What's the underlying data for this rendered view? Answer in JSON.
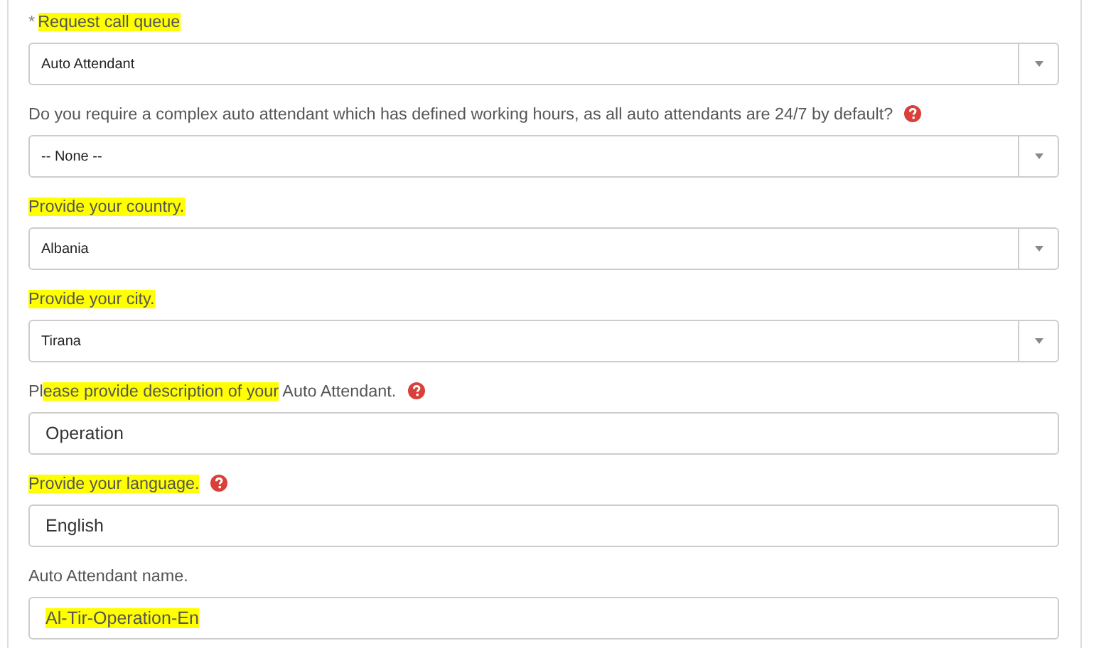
{
  "fields": [
    {
      "kind": "select",
      "required_mark": "*",
      "help": false,
      "label_parts": [
        {
          "text": "Request call queue",
          "highlighted": true
        }
      ],
      "value": "Auto Attendant"
    },
    {
      "kind": "select",
      "help": true,
      "label_parts": [
        {
          "text": "Do you require a complex auto attendant which has defined working hours, as all auto attendants are 24/7 by default?",
          "highlighted": false
        }
      ],
      "value": "-- None --"
    },
    {
      "kind": "select",
      "help": false,
      "label_parts": [
        {
          "text": "Provide your country.",
          "highlighted": true
        }
      ],
      "value": "Albania"
    },
    {
      "kind": "select",
      "help": false,
      "label_parts": [
        {
          "text": "Provide your city.",
          "highlighted": true
        }
      ],
      "value": "Tirana"
    },
    {
      "kind": "text",
      "help": true,
      "label_parts": [
        {
          "text": "Pl",
          "highlighted": false
        },
        {
          "text": "ease provide description of your",
          "highlighted": true
        },
        {
          "text": " Auto Attendant.",
          "highlighted": false
        }
      ],
      "value": "Operation",
      "value_highlighted": false
    },
    {
      "kind": "text",
      "help": true,
      "label_parts": [
        {
          "text": "Provide your language.",
          "highlighted": true
        }
      ],
      "value": "English",
      "value_highlighted": false
    },
    {
      "kind": "text",
      "help": false,
      "label_parts": [
        {
          "text": "Auto Attendant name.",
          "highlighted": false
        }
      ],
      "value": "Al-Tir-Operation-En",
      "value_highlighted": true
    }
  ]
}
